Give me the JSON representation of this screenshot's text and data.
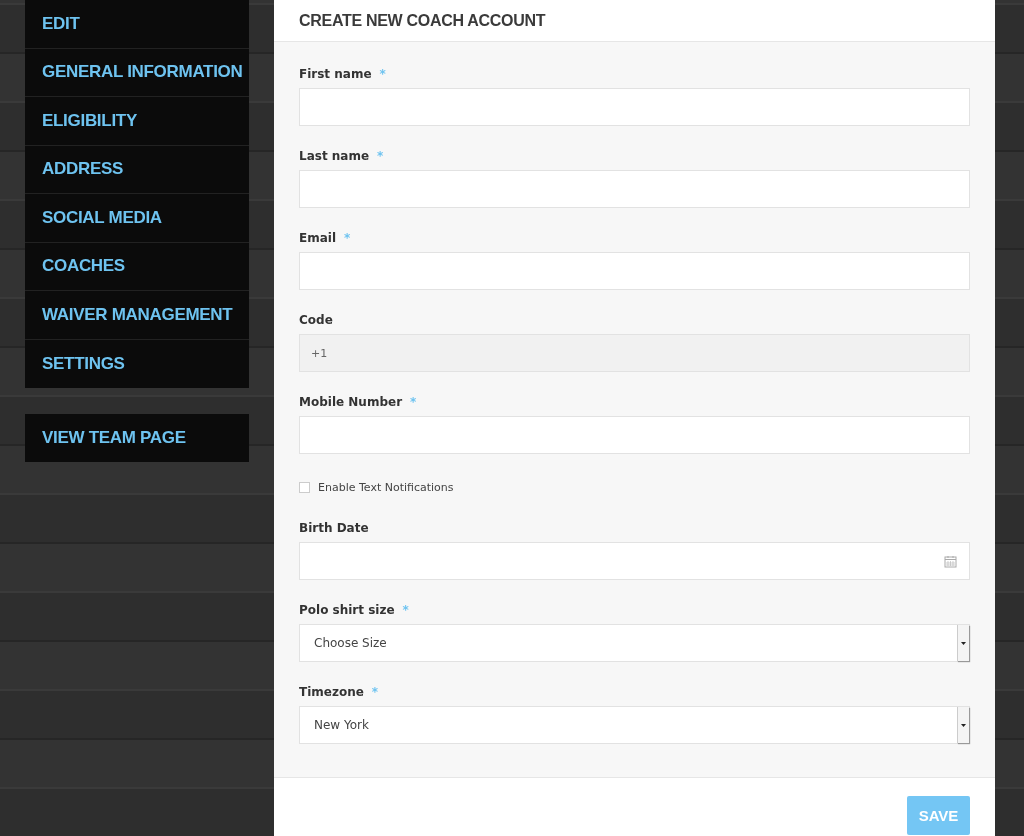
{
  "sidebar": {
    "items": [
      {
        "label": "EDIT"
      },
      {
        "label": "GENERAL INFORMATION"
      },
      {
        "label": "ELIGIBILITY"
      },
      {
        "label": "ADDRESS"
      },
      {
        "label": "SOCIAL MEDIA"
      },
      {
        "label": "COACHES"
      },
      {
        "label": "WAIVER MANAGEMENT"
      },
      {
        "label": "SETTINGS"
      }
    ],
    "link": "VIEW TEAM PAGE"
  },
  "form": {
    "title": "CREATE NEW COACH ACCOUNT",
    "fields": [
      {
        "kind": "text",
        "label": "First name",
        "required_mark": "*"
      },
      {
        "kind": "text",
        "label": "Last name",
        "required_mark": "*"
      },
      {
        "kind": "text",
        "label": "Email",
        "required_mark": "*"
      },
      {
        "kind": "readonly",
        "label": "Code",
        "value": "+1"
      },
      {
        "kind": "text",
        "label": "Mobile Number",
        "required_mark": "*"
      },
      {
        "kind": "checkbox",
        "label": "Enable Text Notifications",
        "checked": false
      },
      {
        "kind": "date",
        "label": "Birth Date"
      },
      {
        "kind": "select",
        "label": "Polo shirt size",
        "required_mark": "*",
        "value": "Choose Size"
      },
      {
        "kind": "select",
        "label": "Timezone",
        "required_mark": "*",
        "value": "New York"
      }
    ],
    "save": "SAVE"
  }
}
